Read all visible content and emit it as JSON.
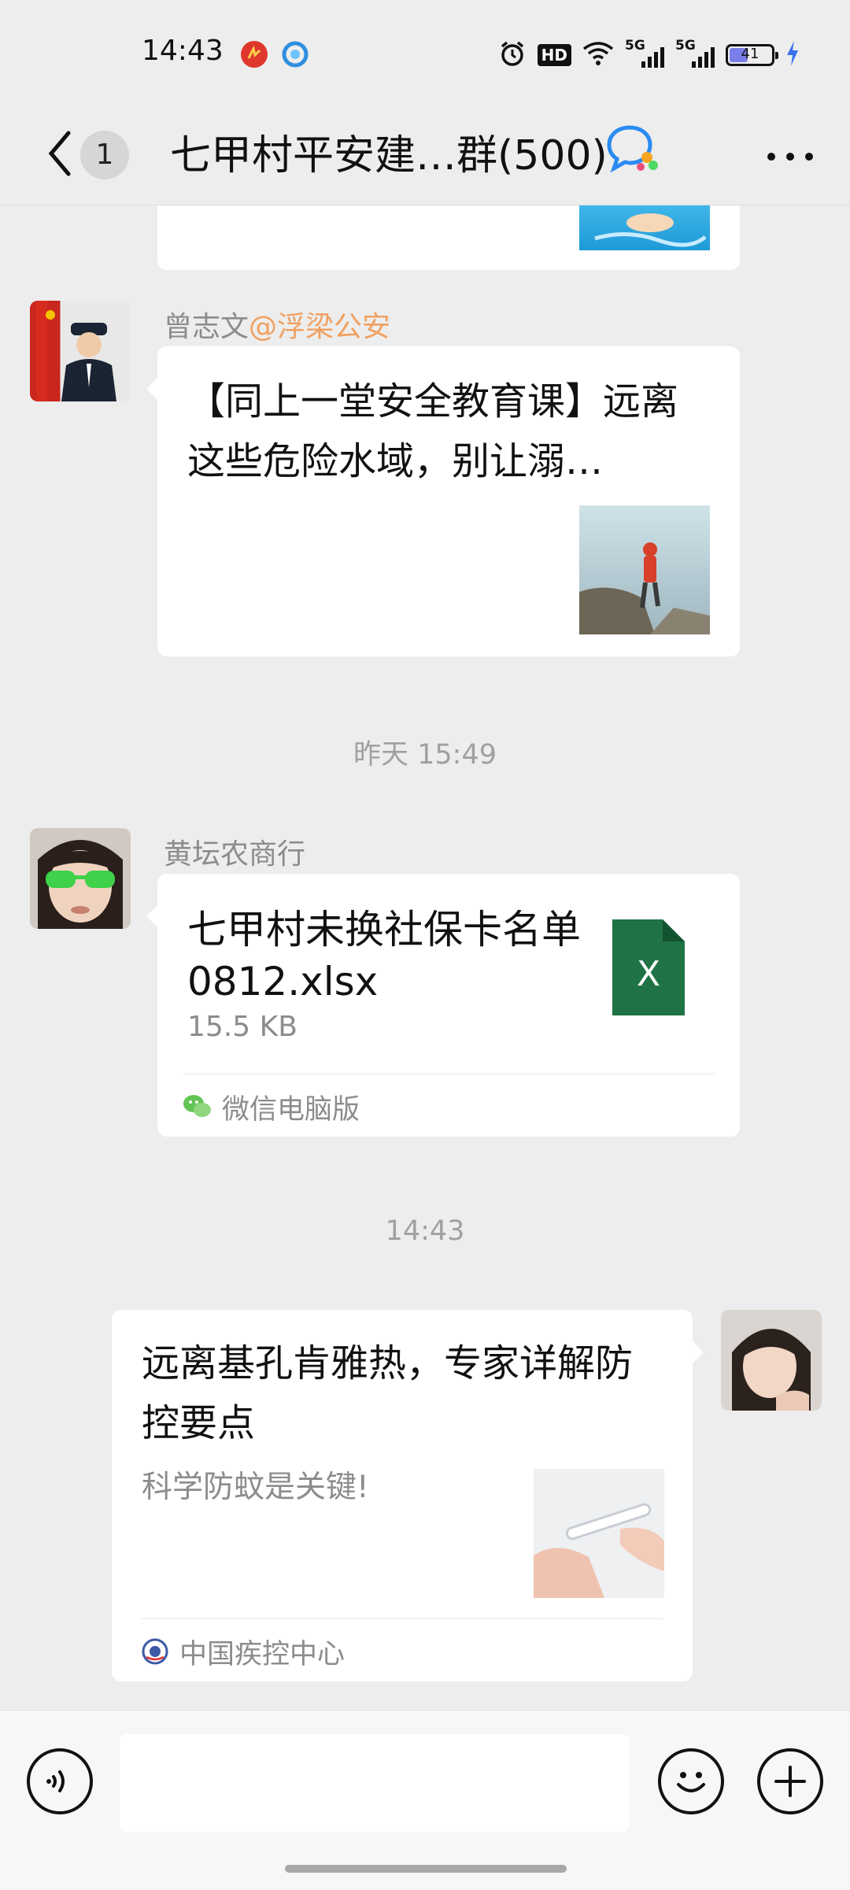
{
  "status_bar": {
    "time": "14:43",
    "signal_1": "5G",
    "signal_2": "5G",
    "hd_label": "HD",
    "battery_level": "41",
    "icons": [
      "app-red-icon",
      "app-blue-icon",
      "alarm-icon",
      "hd-voice-icon",
      "wifi-icon",
      "signal-icon",
      "battery-icon",
      "charging-icon"
    ]
  },
  "header": {
    "unread_count": "1",
    "title": "七甲村平安建…群(500)",
    "icons": [
      "back-chevron-icon",
      "group-chat-icon",
      "more-icon"
    ]
  },
  "messages": {
    "link1": {
      "sender_name": "曾志文",
      "sender_mention": "@浮梁公安",
      "title": "【同上一堂安全教育课】远离这些危险水域，别让溺…"
    },
    "timestamp1": "昨天 15:49",
    "file_msg": {
      "sender_name": "黄坛农商行",
      "file_name": "七甲村未换社保卡名单0812.xlsx",
      "file_size": "15.5 KB",
      "file_icon_letter": "X",
      "source": "微信电脑版"
    },
    "timestamp2": "14:43",
    "link2": {
      "title": "远离基孔肯雅热，专家详解防控要点",
      "desc": "科学防蚊是关键!",
      "source": "中国疾控中心"
    }
  },
  "input_bar": {
    "placeholder": "",
    "icons": [
      "voice-icon",
      "emoji-icon",
      "plus-icon"
    ]
  },
  "colors": {
    "background": "#ededed",
    "bubble": "#ffffff",
    "mention": "#f0a061",
    "excel_green": "#1f7244"
  }
}
